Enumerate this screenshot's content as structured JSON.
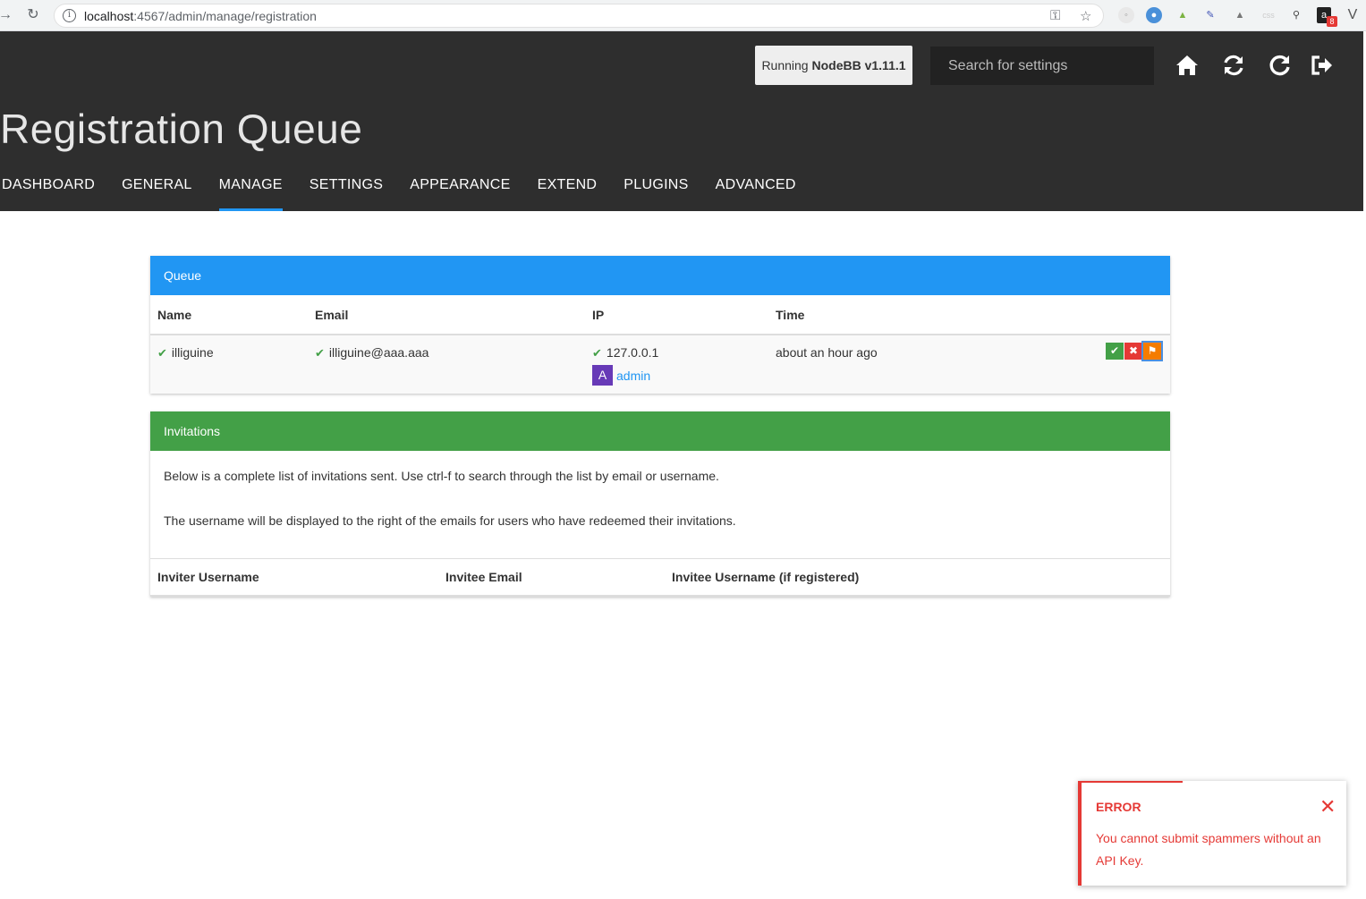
{
  "browser": {
    "url_host": "localhost",
    "url_path": ":4567/admin/manage/registration",
    "extension_badge": "8"
  },
  "header": {
    "version_prefix": "Running ",
    "version_name": "NodeBB v1.11.1",
    "search_placeholder": "Search for settings",
    "page_title": "Registration Queue",
    "tabs": [
      {
        "label": "DASHBOARD"
      },
      {
        "label": "GENERAL"
      },
      {
        "label": "MANAGE",
        "active": true
      },
      {
        "label": "SETTINGS"
      },
      {
        "label": "APPEARANCE"
      },
      {
        "label": "EXTEND"
      },
      {
        "label": "PLUGINS"
      },
      {
        "label": "ADVANCED"
      }
    ],
    "icons": [
      "home-icon",
      "refresh-icon",
      "restart-icon",
      "logout-icon"
    ]
  },
  "queue": {
    "heading": "Queue",
    "columns": [
      "Name",
      "Email",
      "IP",
      "Time"
    ],
    "rows": [
      {
        "name": "illiguine",
        "email": "illiguine@aaa.aaa",
        "ip": "127.0.0.1",
        "ip_user_avatar": "A",
        "ip_user": "admin",
        "time": "about an hour ago"
      }
    ],
    "actions": [
      "accept",
      "reject",
      "spam"
    ]
  },
  "invitations": {
    "heading": "Invitations",
    "text1": "Below is a complete list of invitations sent. Use ctrl-f to search through the list by email or username.",
    "text2": "The username will be displayed to the right of the emails for users who have redeemed their invitations.",
    "columns": [
      "Inviter Username",
      "Invitee Email",
      "Invitee Username (if registered)"
    ]
  },
  "toast": {
    "title": "ERROR",
    "message": "You cannot submit spammers without an API Key."
  },
  "colors": {
    "header_bg": "#2e2e2e",
    "queue_heading": "#2196f3",
    "invitations_heading": "#43a047",
    "accept": "#43a047",
    "reject": "#e53935",
    "spam": "#f57c00",
    "error": "#e53935"
  }
}
